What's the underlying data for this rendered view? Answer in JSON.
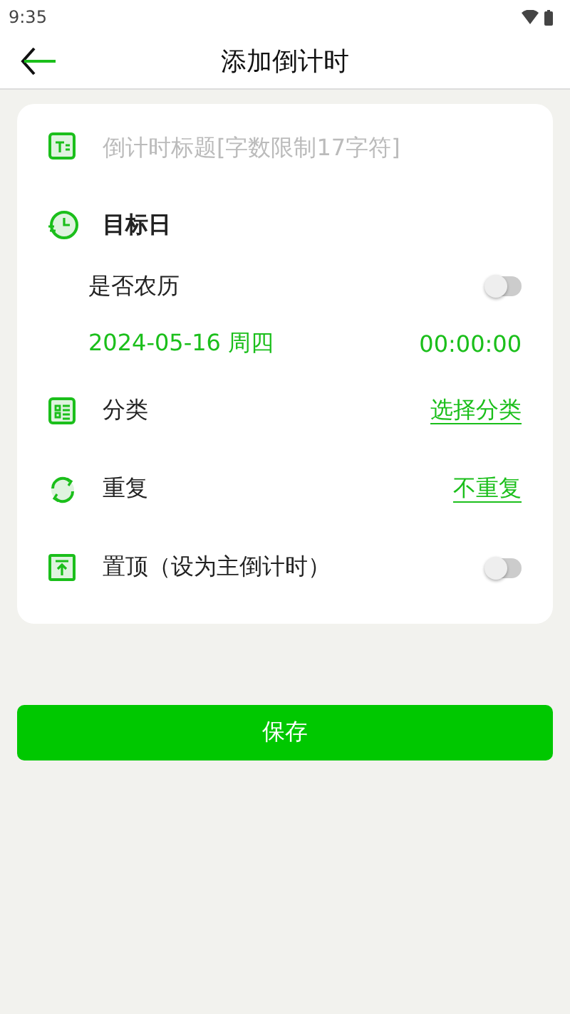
{
  "status_bar": {
    "time": "9:35"
  },
  "header": {
    "title": "添加倒计时"
  },
  "title_field": {
    "placeholder": "倒计时标题[字数限制17字符]"
  },
  "target_date": {
    "label": "目标日",
    "lunar": {
      "label": "是否农历",
      "on": false
    },
    "date": "2024-05-16 周四",
    "time": "00:00:00"
  },
  "rows": [
    {
      "kind": "link",
      "label": "分类",
      "value": "选择分类"
    },
    {
      "kind": "link",
      "label": "重复",
      "value": "不重复"
    },
    {
      "kind": "toggle",
      "label": "置顶（设为主倒计时）",
      "on": false
    }
  ],
  "save_button": "保存"
}
